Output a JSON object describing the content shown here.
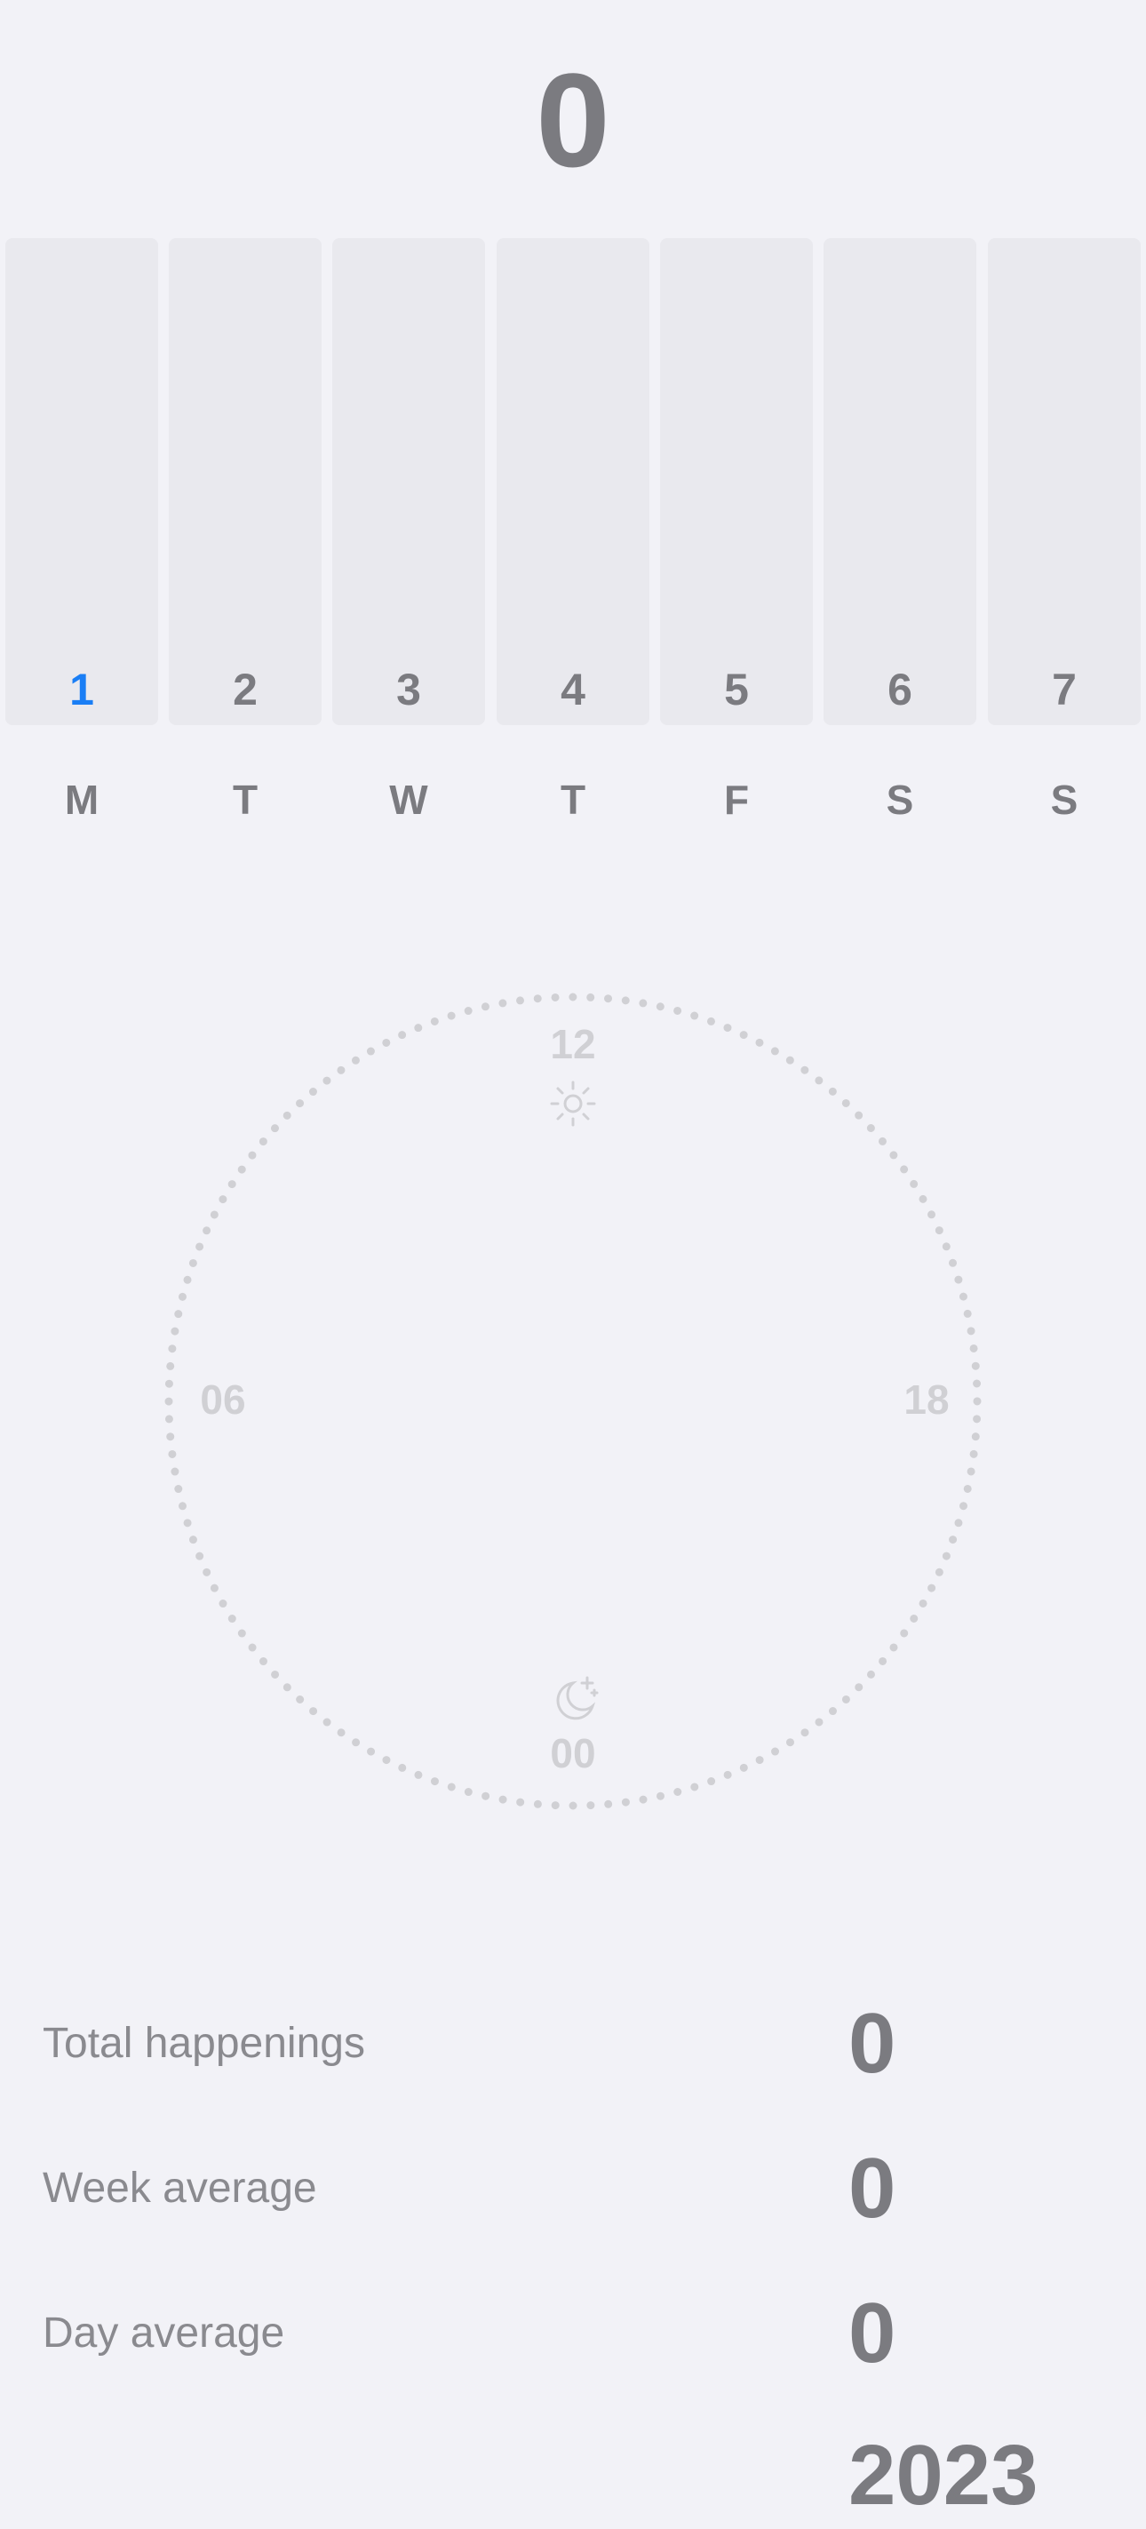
{
  "header": {
    "total_count": "0"
  },
  "week": {
    "days": [
      {
        "number": "1",
        "weekday": "M",
        "current": true
      },
      {
        "number": "2",
        "weekday": "T",
        "current": false
      },
      {
        "number": "3",
        "weekday": "W",
        "current": false
      },
      {
        "number": "4",
        "weekday": "T",
        "current": false
      },
      {
        "number": "5",
        "weekday": "F",
        "current": false
      },
      {
        "number": "6",
        "weekday": "S",
        "current": false
      },
      {
        "number": "7",
        "weekday": "S",
        "current": false
      }
    ]
  },
  "clock": {
    "label_top": "12",
    "label_left": "06",
    "label_right": "18",
    "label_bottom": "00",
    "top_icon": "sun-icon",
    "bottom_icon": "moon-stars-icon"
  },
  "stats": {
    "total_label": "Total happenings",
    "total_value": "0",
    "week_avg_label": "Week average",
    "week_avg_value": "0",
    "day_avg_label": "Day average",
    "day_avg_value": "0",
    "partial_value": "2023"
  },
  "colors": {
    "background": "#f2f2f7",
    "bar": "#e9e9ee",
    "accent": "#1a7ef5",
    "text": "#7b7b80",
    "faint": "#d0d0d4"
  }
}
